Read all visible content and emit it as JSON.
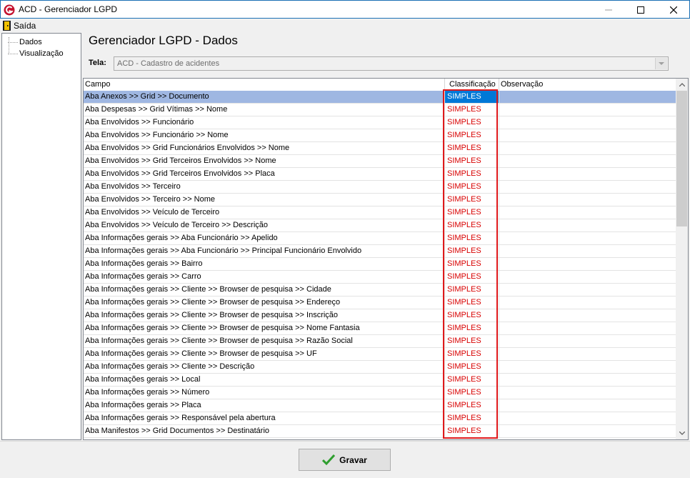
{
  "window": {
    "title": "ACD - Gerenciador LGPD"
  },
  "menu": {
    "exit_label": "Saída"
  },
  "tree": {
    "items": [
      "Dados",
      "Visualização"
    ]
  },
  "page": {
    "heading": "Gerenciador LGPD - Dados"
  },
  "tela": {
    "label": "Tela:",
    "value": "ACD - Cadastro de acidentes"
  },
  "grid": {
    "columns": [
      "Campo",
      "Classificação",
      "Observação"
    ],
    "rows": [
      {
        "campo": "Aba Anexos >> Grid >> Documento",
        "classificacao": "SIMPLES",
        "observacao": ""
      },
      {
        "campo": "Aba Despesas >> Grid Vítimas >> Nome",
        "classificacao": "SIMPLES",
        "observacao": ""
      },
      {
        "campo": "Aba Envolvidos >> Funcionário",
        "classificacao": "SIMPLES",
        "observacao": ""
      },
      {
        "campo": "Aba Envolvidos >> Funcionário >> Nome",
        "classificacao": "SIMPLES",
        "observacao": ""
      },
      {
        "campo": "Aba Envolvidos >> Grid Funcionários Envolvidos >> Nome",
        "classificacao": "SIMPLES",
        "observacao": ""
      },
      {
        "campo": "Aba Envolvidos >> Grid Terceiros Envolvidos >> Nome",
        "classificacao": "SIMPLES",
        "observacao": ""
      },
      {
        "campo": "Aba Envolvidos >> Grid Terceiros Envolvidos >> Placa",
        "classificacao": "SIMPLES",
        "observacao": ""
      },
      {
        "campo": "Aba Envolvidos >> Terceiro",
        "classificacao": "SIMPLES",
        "observacao": ""
      },
      {
        "campo": "Aba Envolvidos >> Terceiro >> Nome",
        "classificacao": "SIMPLES",
        "observacao": ""
      },
      {
        "campo": "Aba Envolvidos >> Veículo de Terceiro",
        "classificacao": "SIMPLES",
        "observacao": ""
      },
      {
        "campo": "Aba Envolvidos >> Veículo de Terceiro >> Descrição",
        "classificacao": "SIMPLES",
        "observacao": ""
      },
      {
        "campo": "Aba Informações gerais >> Aba Funcionário >> Apelido",
        "classificacao": "SIMPLES",
        "observacao": ""
      },
      {
        "campo": "Aba Informações gerais >> Aba Funcionário >> Principal Funcionário Envolvido",
        "classificacao": "SIMPLES",
        "observacao": ""
      },
      {
        "campo": "Aba Informações gerais >> Bairro",
        "classificacao": "SIMPLES",
        "observacao": ""
      },
      {
        "campo": "Aba Informações gerais >> Carro",
        "classificacao": "SIMPLES",
        "observacao": ""
      },
      {
        "campo": "Aba Informações gerais >> Cliente >> Browser de pesquisa >> Cidade",
        "classificacao": "SIMPLES",
        "observacao": ""
      },
      {
        "campo": "Aba Informações gerais >> Cliente >> Browser de pesquisa >> Endereço",
        "classificacao": "SIMPLES",
        "observacao": ""
      },
      {
        "campo": "Aba Informações gerais >> Cliente >> Browser de pesquisa >> Inscrição",
        "classificacao": "SIMPLES",
        "observacao": ""
      },
      {
        "campo": "Aba Informações gerais >> Cliente >> Browser de pesquisa >> Nome Fantasia",
        "classificacao": "SIMPLES",
        "observacao": ""
      },
      {
        "campo": "Aba Informações gerais >> Cliente >> Browser de pesquisa >> Razão Social",
        "classificacao": "SIMPLES",
        "observacao": ""
      },
      {
        "campo": "Aba Informações gerais >> Cliente >> Browser de pesquisa >> UF",
        "classificacao": "SIMPLES",
        "observacao": ""
      },
      {
        "campo": "Aba Informações gerais >> Cliente >> Descrição",
        "classificacao": "SIMPLES",
        "observacao": ""
      },
      {
        "campo": "Aba Informações gerais >> Local",
        "classificacao": "SIMPLES",
        "observacao": ""
      },
      {
        "campo": "Aba Informações gerais >> Número",
        "classificacao": "SIMPLES",
        "observacao": ""
      },
      {
        "campo": "Aba Informações gerais >> Placa",
        "classificacao": "SIMPLES",
        "observacao": ""
      },
      {
        "campo": "Aba Informações gerais >> Responsável pela abertura",
        "classificacao": "SIMPLES",
        "observacao": ""
      },
      {
        "campo": "Aba Manifestos >> Grid Documentos >> Destinatário",
        "classificacao": "SIMPLES",
        "observacao": ""
      }
    ],
    "selected_row": 0
  },
  "footer": {
    "save_label": "Gravar"
  },
  "colors": {
    "classification_text": "#d80000",
    "selection": "#0078d7",
    "highlight_border": "#e0191b",
    "save_icon": "#2e9e2e"
  },
  "icons": {
    "app": "app-logo-icon",
    "exit": "exit-door-icon",
    "save": "checkmark-icon"
  }
}
